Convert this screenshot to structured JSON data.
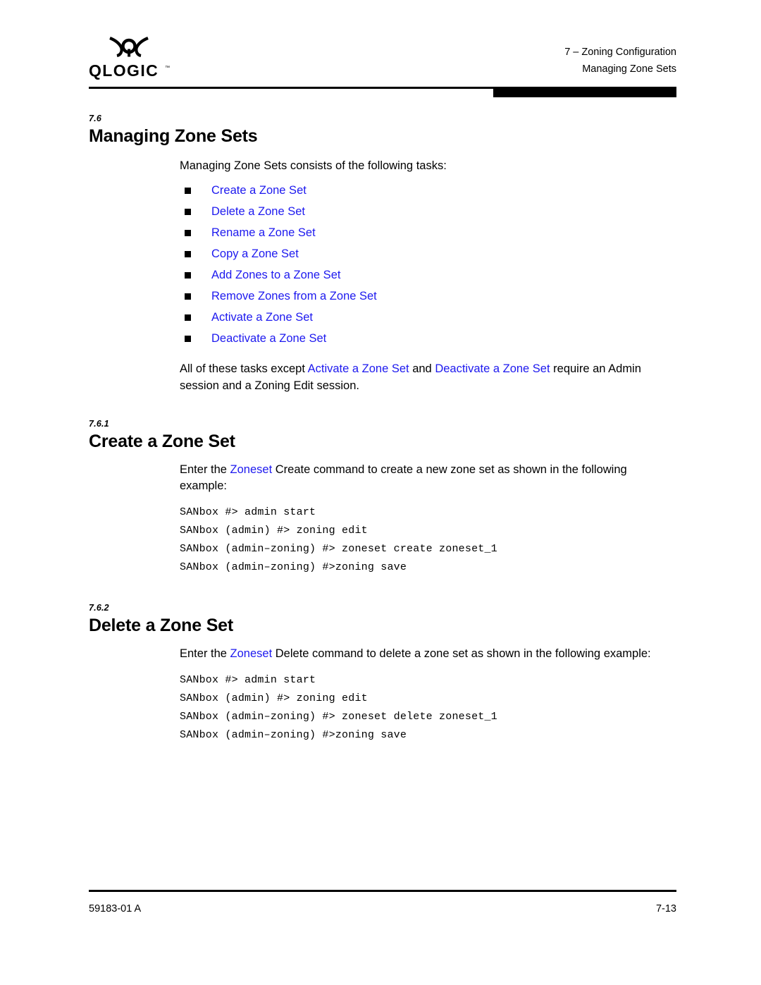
{
  "document": {
    "logo": {
      "mark_icon": "qlogic-q-mark-icon",
      "wordmark": "QLOGIC",
      "trademark": "™"
    },
    "header": {
      "chapter_line": "7 – Zoning Configuration",
      "section_line": "Managing Zone Sets"
    },
    "footer": {
      "doc_number": "59183-01 A",
      "page_number": "7-13"
    },
    "colors": {
      "link": "#1d19ef",
      "text": "#000000",
      "rule": "#000000",
      "page_background": "#ffffff"
    }
  },
  "sections": [
    {
      "number": "7.6",
      "title": "Managing Zone Sets",
      "intro": "Managing Zone Sets consists of the following tasks:",
      "bullets": [
        {
          "label": "Create a Zone Set",
          "is_link": true
        },
        {
          "label": "Delete a Zone Set",
          "is_link": true
        },
        {
          "label": "Rename a Zone Set",
          "is_link": true
        },
        {
          "label": "Copy a Zone Set",
          "is_link": true
        },
        {
          "label": "Add Zones to a Zone Set",
          "is_link": true
        },
        {
          "label": "Remove Zones from a Zone Set",
          "is_link": true
        },
        {
          "label": "Activate a Zone Set",
          "is_link": true
        },
        {
          "label": "Deactivate a Zone Set",
          "is_link": true
        }
      ],
      "closing": {
        "part1": "All of these tasks except ",
        "link1": "Activate a Zone Set",
        "part2": " and ",
        "link2": "Deactivate a Zone Set",
        "part3": " require an Admin session and a Zoning Edit session."
      }
    },
    {
      "number": "7.6.1",
      "title": "Create a Zone Set",
      "lead": {
        "part1": "Enter the ",
        "link1": "Zoneset",
        "part2": " Create command to create a new zone set as shown in the following example:"
      },
      "code": "SANbox #> admin start\nSANbox (admin) #> zoning edit\nSANbox (admin–zoning) #> zoneset create zoneset_1\nSANbox (admin–zoning) #>zoning save"
    },
    {
      "number": "7.6.2",
      "title": "Delete a Zone Set",
      "lead": {
        "part1": "Enter the ",
        "link1": "Zoneset",
        "part2": " Delete command to delete a zone set as shown in the following example:"
      },
      "code": "SANbox #> admin start\nSANbox (admin) #> zoning edit\nSANbox (admin–zoning) #> zoneset delete zoneset_1\nSANbox (admin–zoning) #>zoning save"
    }
  ]
}
